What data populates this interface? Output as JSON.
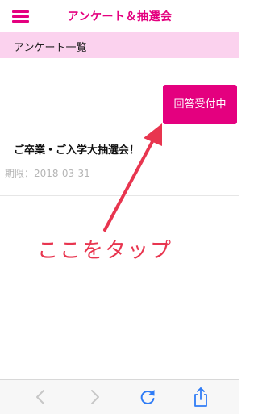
{
  "colors": {
    "accent": "#e4007f",
    "section_bg": "#fbd2ee",
    "annotation": "#e8354f",
    "toolbar_bg": "#f7f7f7",
    "toolbar_icon_active": "#2f7cf6",
    "toolbar_icon_disabled": "#c7c7c7"
  },
  "header": {
    "title": "アンケート＆抽選会",
    "menu_icon": "hamburger-menu-icon"
  },
  "section": {
    "label": "アンケート一覧"
  },
  "survey": {
    "status_label": "回答受付中",
    "title": "ご卒業・ご入学大抽選会！",
    "deadline_label": "期限",
    "deadline_separator": "：",
    "deadline_date": "2018-03-31"
  },
  "annotation": {
    "text": "ここをタップ",
    "arrow_icon": "arrow-icon"
  },
  "toolbar": {
    "back_icon": "chevron-left-icon",
    "forward_icon": "chevron-right-icon",
    "reload_icon": "reload-icon",
    "share_icon": "share-icon"
  }
}
